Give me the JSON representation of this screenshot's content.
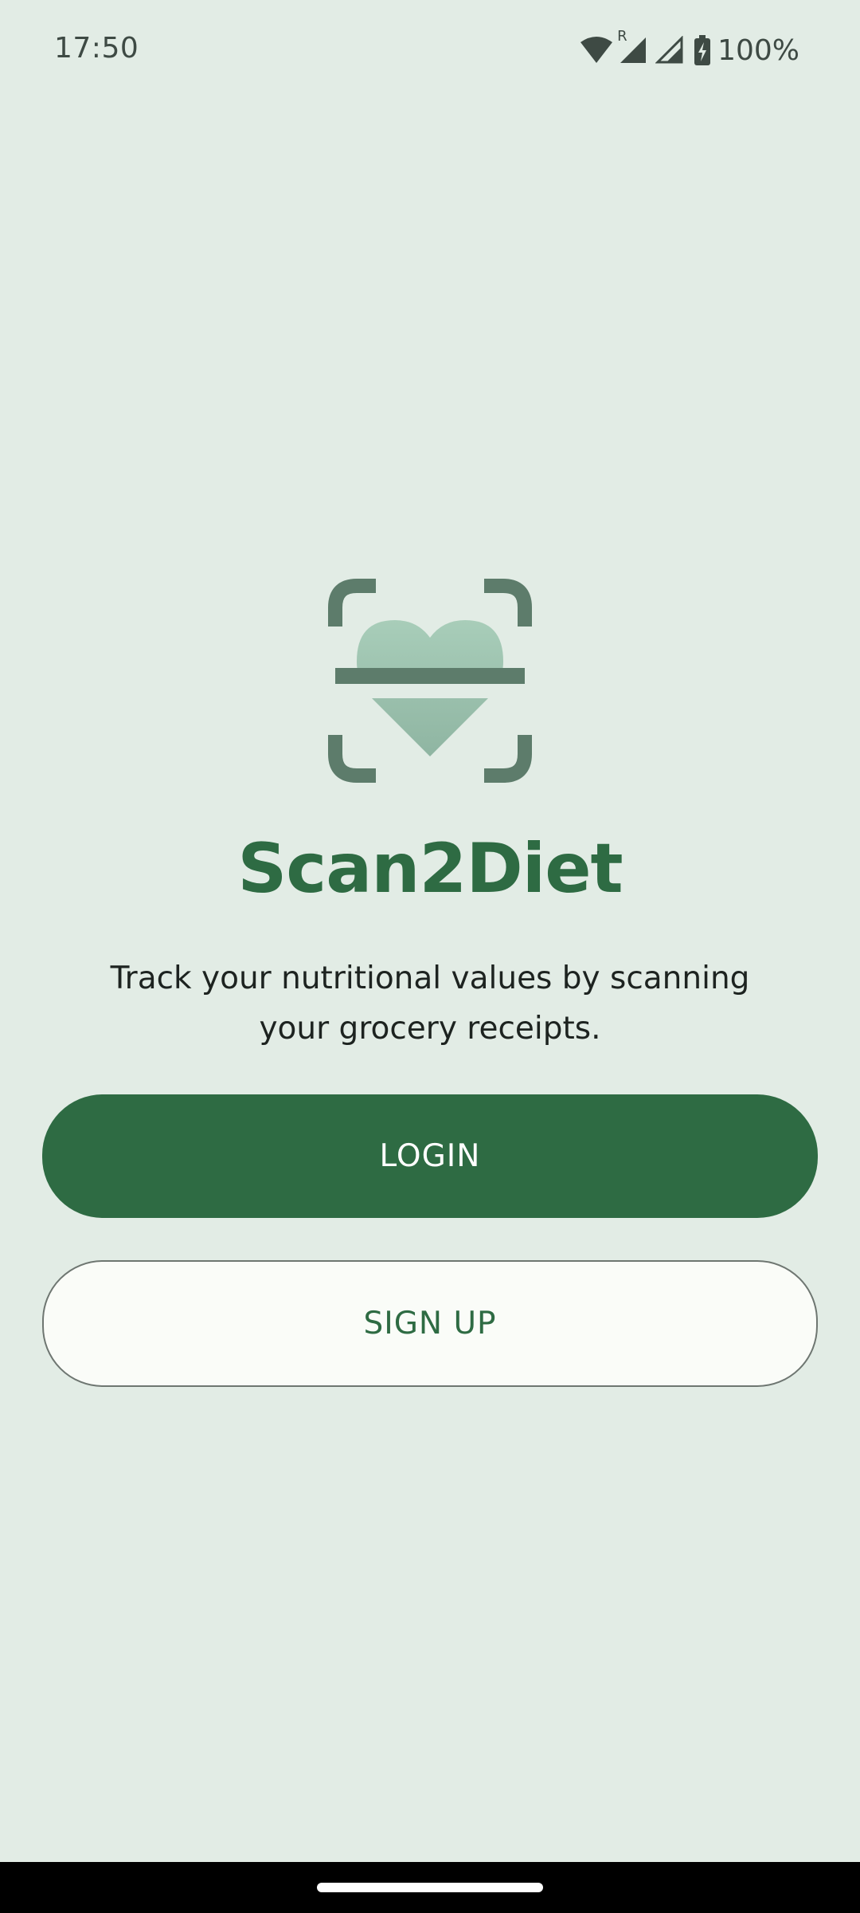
{
  "status_bar": {
    "time": "17:50",
    "wifi_icon": "wifi-icon",
    "roaming_indicator": "R",
    "signal_icons": [
      "signal-icon",
      "signal-icon"
    ],
    "battery_icon": "battery-charging-icon",
    "battery_percent": "100%"
  },
  "splash": {
    "logo_icon": "scan-heart-logo",
    "title": "Scan2Diet",
    "tagline": "Track your nutritional values by scanning your grocery receipts.",
    "login_label": "LOGIN",
    "signup_label": "SIGN UP"
  },
  "colors": {
    "background": "#e2ece5",
    "primary": "#2e6b43",
    "logo_frame": "#5d7c6b",
    "logo_heart": "#a8cdb9"
  }
}
